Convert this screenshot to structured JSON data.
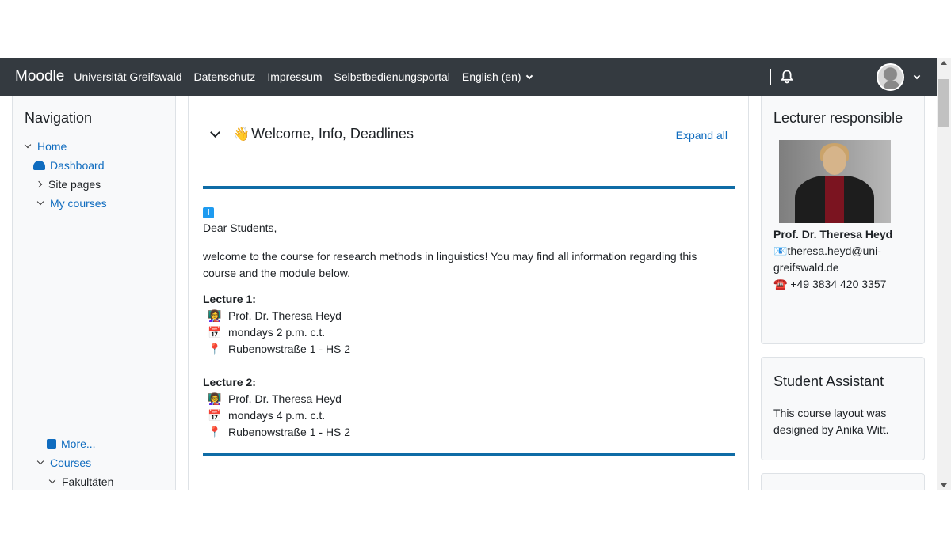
{
  "navbar": {
    "brand": "Moodle",
    "links": [
      "Universität Greifswald",
      "Datenschutz",
      "Impressum",
      "Selbstbedienungsportal"
    ],
    "language": "English (en)"
  },
  "navigation": {
    "title": "Navigation",
    "items": [
      {
        "label": "Home",
        "icon": "chevron-down-icon"
      },
      {
        "label": "Dashboard",
        "icon": "dashboard-icon"
      },
      {
        "label": "Site pages",
        "icon": "chevron-right-icon"
      },
      {
        "label": "My courses",
        "icon": "chevron-down-icon"
      },
      {
        "label": "More...",
        "icon": "square-icon"
      },
      {
        "label": "Courses",
        "icon": "chevron-down-icon"
      },
      {
        "label": "Fakultäten",
        "icon": "chevron-down-icon"
      }
    ]
  },
  "main": {
    "section_emoji": "👋",
    "section_title": "Welcome, Info, Deadlines",
    "expand_all": "Expand all",
    "info_icon": "i",
    "greeting": "Dear Students,",
    "intro": "welcome to the course for research methods in linguistics! You may find all information regarding this course and the module below.",
    "lectures": [
      {
        "title": "Lecture 1:",
        "lecturer": "Prof. Dr. Theresa Heyd",
        "time": "mondays 2 p.m. c.t.",
        "location": "Rubenowstraße 1 - HS 2"
      },
      {
        "title": "Lecture 2:",
        "lecturer": "Prof. Dr. Theresa Heyd",
        "time": "mondays 4 p.m. c.t.",
        "location": "Rubenowstraße 1 - HS 2"
      }
    ]
  },
  "lecturer_block": {
    "title": "Lecturer responsible",
    "name": "Prof. Dr. Theresa Heyd",
    "email_line1": "theresa.heyd@uni-",
    "email_line2": "greifswald.de",
    "phone": "+49 3834 420 3357"
  },
  "assistant_block": {
    "title": "Student Assistant",
    "text_line1": "This course layout was",
    "text_line2": "designed by Anika Witt."
  },
  "colors": {
    "navbar": "#343a40",
    "link": "#0f6cbf",
    "divider": "#0f6ca6"
  }
}
